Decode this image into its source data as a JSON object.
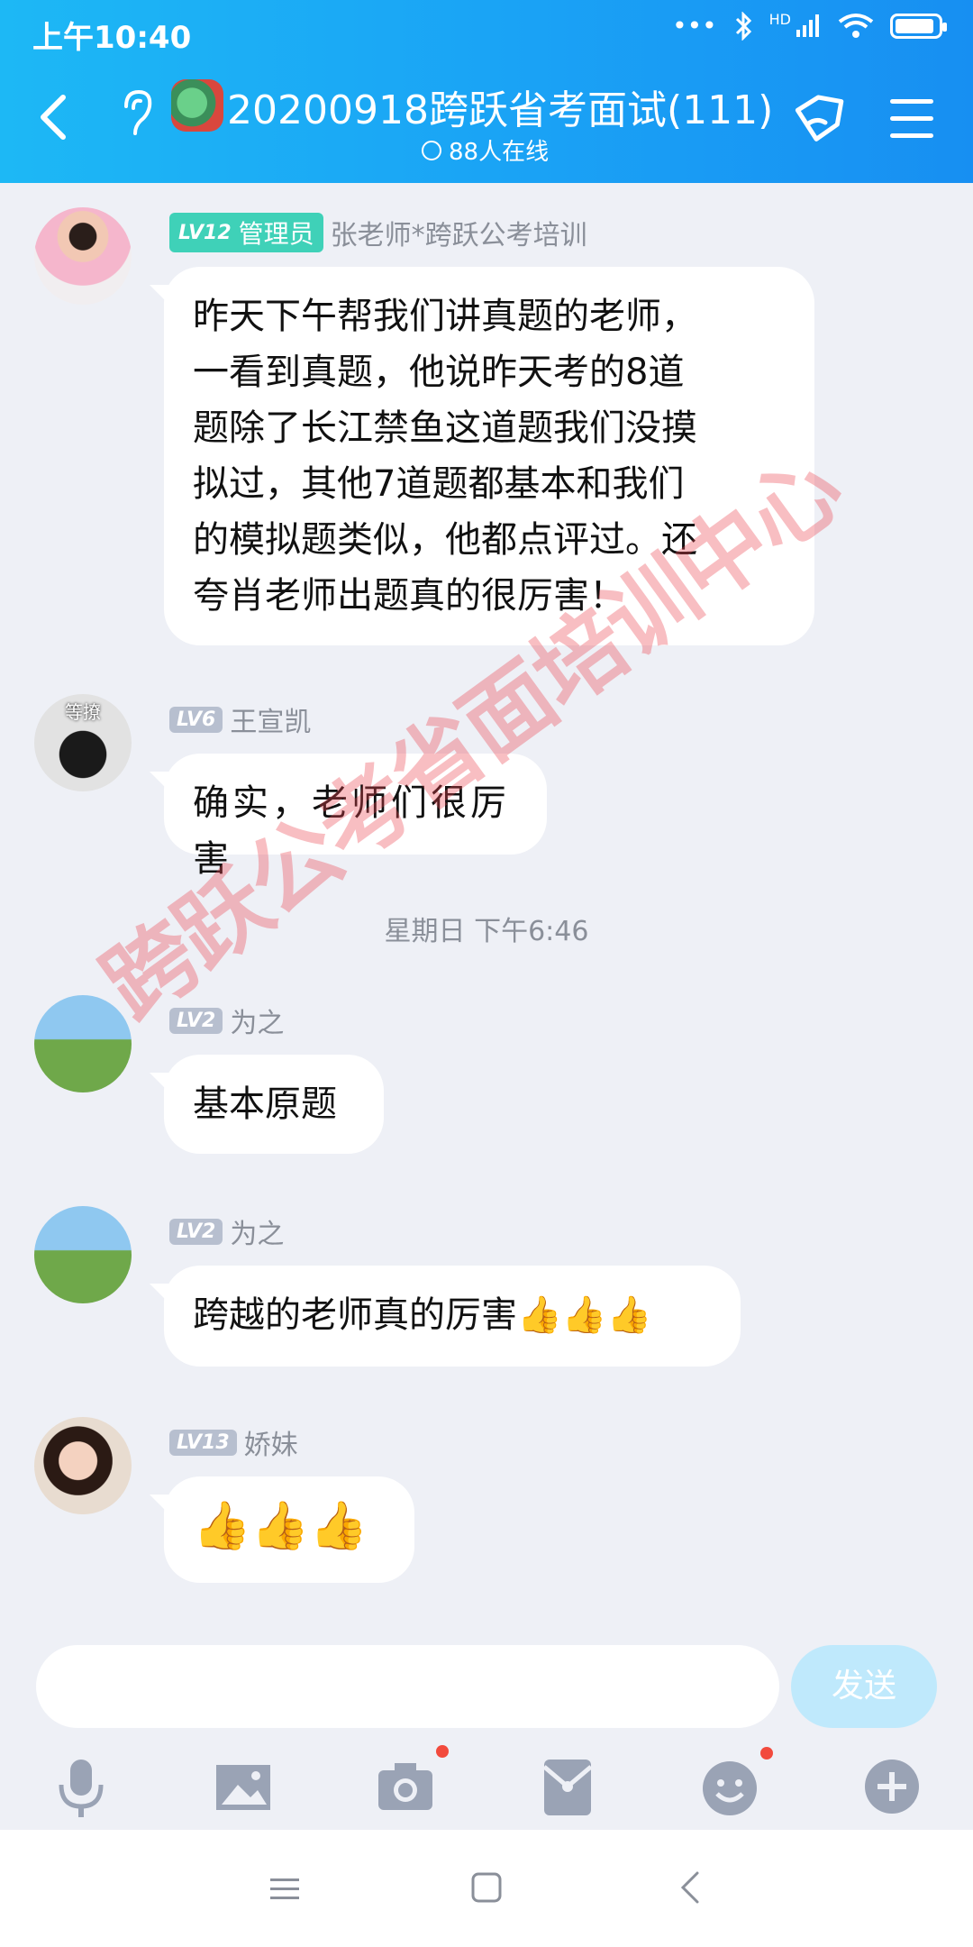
{
  "status": {
    "time": "上午10:40",
    "network": "HD"
  },
  "header": {
    "title": "20200918跨跃省考面试(111)",
    "online": "88人在线"
  },
  "messages": [
    {
      "level": "LV12",
      "role": "管理员",
      "sender": "张老师*跨跃公考培训",
      "lines": [
        "昨天下午帮我们讲真题的老师，",
        "一看到真题，他说昨天考的8道",
        "题除了长江禁鱼这道题我们没摸",
        "拟过，其他7道题都基本和我们",
        "的模拟题类似，他都点评过。还",
        "夸肖老师出题真的很厉害！"
      ]
    },
    {
      "level": "LV6",
      "sender": "王宣凯",
      "avatar_label": "等撩",
      "text": "确实，老师们很厉害"
    },
    {
      "level": "LV2",
      "sender": "为之",
      "text": "基本原题"
    },
    {
      "level": "LV2",
      "sender": "为之",
      "text": "跨越的老师真的厉害👍👍👍"
    },
    {
      "level": "LV13",
      "sender": "娇妹",
      "text": "👍👍👍"
    }
  ],
  "time_separator": "星期日 下午6:46",
  "input": {
    "placeholder": "",
    "send_label": "发送"
  },
  "watermark": "跨跃公考省面培训中心"
}
